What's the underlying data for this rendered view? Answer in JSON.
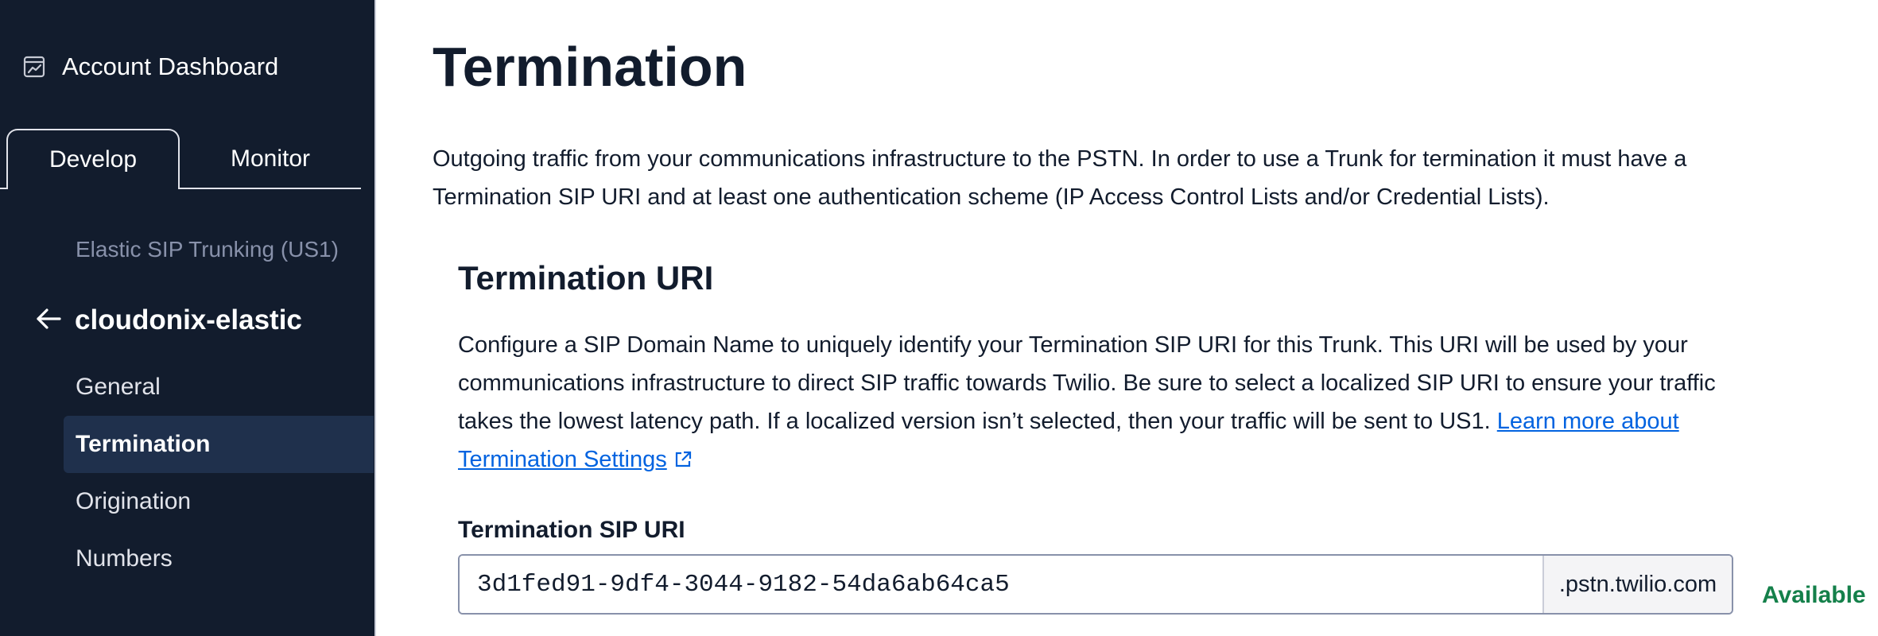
{
  "sidebar": {
    "account_dashboard": "Account Dashboard",
    "tabs": [
      {
        "label": "Develop",
        "active": true
      },
      {
        "label": "Monitor",
        "active": false
      }
    ],
    "parent": "Elastic SIP Trunking (US1)",
    "trunk_name": "cloudonix-elastic",
    "items": [
      {
        "label": "General",
        "active": false
      },
      {
        "label": "Termination",
        "active": true
      },
      {
        "label": "Origination",
        "active": false
      },
      {
        "label": "Numbers",
        "active": false
      }
    ],
    "icons": {
      "dashboard": "chart-icon",
      "back": "arrow-left-icon"
    }
  },
  "main": {
    "title": "Termination",
    "description": "Outgoing traffic from your communications infrastructure to the PSTN. In order to use a Trunk for termination it must have a Termination SIP URI and at least one authentication scheme (IP Access Control Lists and/or Credential Lists).",
    "section": {
      "title": "Termination URI",
      "description": "Configure a SIP Domain Name to uniquely identify your Termination SIP URI for this Trunk. This URI will be used by your communications infrastructure to direct SIP traffic towards Twilio. Be sure to select a localized SIP URI to ensure your traffic takes the lowest latency path. If a localized version isn’t selected, then your traffic will be sent to US1.",
      "link_text": "Learn more about Termination Settings",
      "link_icon": "external-link-icon"
    },
    "field": {
      "label": "Termination SIP URI",
      "value": "3d1fed91-9df4-3044-9182-54da6ab64ca5",
      "suffix": ".pstn.twilio.com",
      "status": "Available"
    }
  },
  "colors": {
    "sidebar_bg": "#121c2d",
    "active_item_bg": "#1f304c",
    "link": "#0263e0",
    "status_ok": "#14804a"
  }
}
